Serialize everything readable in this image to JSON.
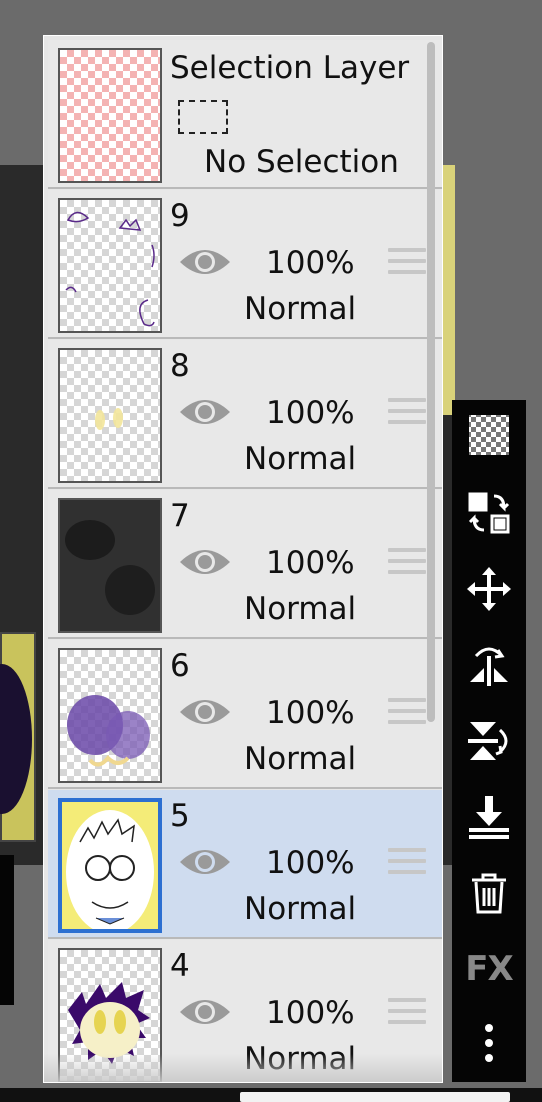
{
  "selection_layer": {
    "title": "Selection Layer",
    "status": "No Selection"
  },
  "layers": [
    {
      "name": "9",
      "opacity": "100%",
      "blend": "Normal",
      "visible": true,
      "selected": false
    },
    {
      "name": "8",
      "opacity": "100%",
      "blend": "Normal",
      "visible": true,
      "selected": false
    },
    {
      "name": "7",
      "opacity": "100%",
      "blend": "Normal",
      "visible": true,
      "selected": false
    },
    {
      "name": "6",
      "opacity": "100%",
      "blend": "Normal",
      "visible": true,
      "selected": false
    },
    {
      "name": "5",
      "opacity": "100%",
      "blend": "Normal",
      "visible": true,
      "selected": true
    },
    {
      "name": "4",
      "opacity": "100%",
      "blend": "Normal",
      "visible": true,
      "selected": false
    }
  ],
  "toolbar": {
    "fx_label": "FX",
    "tools": [
      "transparency-checker-icon",
      "swap-layer-icon",
      "move-icon",
      "flip-horizontal-icon",
      "flip-vertical-icon",
      "merge-down-icon",
      "trash-icon",
      "fx",
      "more-vertical-icon"
    ]
  },
  "colors": {
    "selected_row": "#cfdcef",
    "selected_border": "#2c6fd1",
    "panel_bg": "#e6e6e6",
    "toolbar_bg": "#050505"
  }
}
